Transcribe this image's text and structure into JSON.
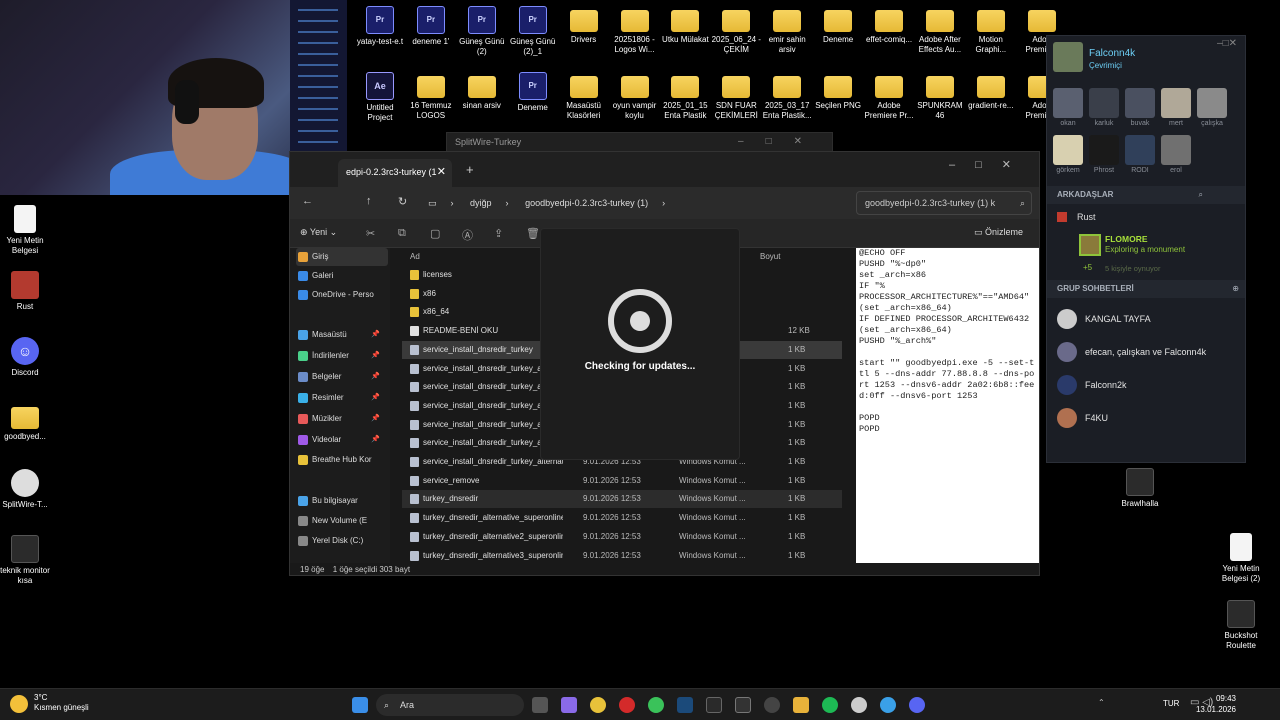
{
  "desktop_top_row": [
    {
      "label": "yatay-test-e.t",
      "kind": "proj"
    },
    {
      "label": "deneme 1'",
      "kind": "proj"
    },
    {
      "label": "Güneş Günü (2)",
      "kind": "proj"
    },
    {
      "label": "Güneş Günü (2)_1",
      "kind": "proj"
    },
    {
      "label": "Drivers",
      "kind": "folder"
    },
    {
      "label": "20251806 -Logos Wi...",
      "kind": "folder"
    },
    {
      "label": "Utku Mülakat",
      "kind": "folder"
    },
    {
      "label": "2025_06_24 - ÇEKİM",
      "kind": "folder"
    },
    {
      "label": "emir sahin arsiv",
      "kind": "folder"
    },
    {
      "label": "Deneme",
      "kind": "folder"
    },
    {
      "label": "effet-comiq...",
      "kind": "folder"
    },
    {
      "label": "Adobe After Effects Au...",
      "kind": "folder"
    },
    {
      "label": "Motion Graphi...",
      "kind": "folder"
    },
    {
      "label": "Adob Premiere",
      "kind": "folder"
    }
  ],
  "desktop_second_row": [
    {
      "label": "Untitled Project",
      "kind": "aep"
    },
    {
      "label": "16 Temmuz LOGOS",
      "kind": "folder"
    },
    {
      "label": "sinan arsiv",
      "kind": "folder"
    },
    {
      "label": "Deneme",
      "kind": "proj"
    },
    {
      "label": "Masaüstü Klasörleri",
      "kind": "folder"
    },
    {
      "label": "oyun vampir koylu",
      "kind": "folder"
    },
    {
      "label": "2025_01_15 Enta Plastik",
      "kind": "folder"
    },
    {
      "label": "SDN FUAR ÇEKİMLERİ",
      "kind": "folder"
    },
    {
      "label": "2025_03_17 Enta Plastik...",
      "kind": "folder"
    },
    {
      "label": "Seçilen PNG",
      "kind": "folder"
    },
    {
      "label": "Adobe Premiere Pr...",
      "kind": "folder"
    },
    {
      "label": "SPUNKRAM 46",
      "kind": "folder"
    },
    {
      "label": "gradient-re...",
      "kind": "folder"
    },
    {
      "label": "Adob Premiere",
      "kind": "folder"
    }
  ],
  "desktop_left": [
    {
      "label": "Yeni Metin Belgesi",
      "kind": "txt"
    },
    {
      "label": "Rust",
      "kind": "red"
    },
    {
      "label": "Discord",
      "kind": "discord"
    },
    {
      "label": "goodbyed...",
      "kind": "folder"
    },
    {
      "label": "SplitWire-T...",
      "kind": "split"
    },
    {
      "label": "teknik monitor kısa",
      "kind": "dark"
    }
  ],
  "desktop_right": [
    {
      "label": "Brawlhalla",
      "kind": "dark"
    },
    {
      "label": "Yeni Metin Belgesi (2)",
      "kind": "txt"
    },
    {
      "label": "Buckshot Roulette",
      "kind": "dark"
    }
  ],
  "splitwire": {
    "title": "SplitWire-Turkey"
  },
  "explorer": {
    "tab_title": "edpi-0.2.3rc3-turkey (1",
    "breadcrumb": [
      "dyiğp",
      "goodbyedpi-0.2.3rc3-turkey (1)"
    ],
    "search_placeholder": "goodbyedpi-0.2.3rc3-turkey (1) k",
    "new_button": "Yeni",
    "preview_button": "Önizleme",
    "col_name": "Ad",
    "col_size": "Boyut",
    "nav": [
      {
        "label": "Giriş",
        "color": "#e8a23a",
        "pin": false
      },
      {
        "label": "Galeri",
        "color": "#3a8be8",
        "pin": false
      },
      {
        "label": "OneDrive - Perso",
        "color": "#3a8be8",
        "pin": false
      },
      {
        "label": "Masaüstü",
        "color": "#4aa3e8",
        "pin": true
      },
      {
        "label": "İndirilenler",
        "color": "#4ad08a",
        "pin": true
      },
      {
        "label": "Belgeler",
        "color": "#6b8cc8",
        "pin": true
      },
      {
        "label": "Resimler",
        "color": "#3ab0e8",
        "pin": true
      },
      {
        "label": "Müzikler",
        "color": "#e85a5a",
        "pin": true
      },
      {
        "label": "Videolar",
        "color": "#a05ae8",
        "pin": true
      },
      {
        "label": "Breathe Hub Kor",
        "color": "#e8c23a",
        "pin": false
      },
      {
        "label": "Bu bilgisayar",
        "color": "#4aa3e8",
        "pin": false
      },
      {
        "label": "New Volume (E",
        "color": "#888888",
        "pin": false
      },
      {
        "label": "Yerel Disk (C:)",
        "color": "#888888",
        "pin": false
      }
    ],
    "files": [
      {
        "name": "licenses",
        "date": "",
        "type": "",
        "size": "",
        "kind": "folder"
      },
      {
        "name": "x86",
        "date": "",
        "type": "",
        "size": "",
        "kind": "folder"
      },
      {
        "name": "x86_64",
        "date": "",
        "type": "",
        "size": "",
        "kind": "folder"
      },
      {
        "name": "README-BENİ OKU",
        "date": "",
        "type": "",
        "size": "12 KB",
        "kind": "txt"
      },
      {
        "name": "service_install_dnsredir_turkey",
        "date": "",
        "type": "",
        "size": "1 KB",
        "kind": "cmd",
        "selected": true
      },
      {
        "name": "service_install_dnsredir_turkey_alte",
        "date": "",
        "type": "...",
        "size": "1 KB",
        "kind": "cmd"
      },
      {
        "name": "service_install_dnsredir_turkey_alte",
        "date": "",
        "type": "",
        "size": "1 KB",
        "kind": "cmd"
      },
      {
        "name": "service_install_dnsredir_turkey_alte",
        "date": "",
        "type": "",
        "size": "1 KB",
        "kind": "cmd"
      },
      {
        "name": "service_install_dnsredir_turkey_alte",
        "date": "",
        "type": "...",
        "size": "1 KB",
        "kind": "cmd"
      },
      {
        "name": "service_install_dnsredir_turkey_alte",
        "date": "",
        "type": "",
        "size": "1 KB",
        "kind": "cmd"
      },
      {
        "name": "service_install_dnsredir_turkey_alternativ...",
        "date": "9.01.2026 12:53",
        "type": "Windows Komut ...",
        "size": "1 KB",
        "kind": "cmd"
      },
      {
        "name": "service_remove",
        "date": "9.01.2026 12:53",
        "type": "Windows Komut ...",
        "size": "1 KB",
        "kind": "cmd"
      },
      {
        "name": "turkey_dnsredir",
        "date": "9.01.2026 12:53",
        "type": "Windows Komut ...",
        "size": "1 KB",
        "kind": "cmd",
        "hover": true
      },
      {
        "name": "turkey_dnsredir_alternative_superonline",
        "date": "9.01.2026 12:53",
        "type": "Windows Komut ...",
        "size": "1 KB",
        "kind": "cmd"
      },
      {
        "name": "turkey_dnsredir_alternative2_superonline",
        "date": "9.01.2026 12:53",
        "type": "Windows Komut ...",
        "size": "1 KB",
        "kind": "cmd"
      },
      {
        "name": "turkey_dnsredir_alternative3_superonline",
        "date": "9.01.2026 12:53",
        "type": "Windows Komut ...",
        "size": "1 KB",
        "kind": "cmd"
      }
    ],
    "preview_text": "@ECHO OFF\nPUSHD \"%~dp0\"\nset _arch=x86\nIF \"%\nPROCESSOR_ARCHITECTURE%\"==\"AMD64\"\n(set _arch=x86_64)\nIF DEFINED PROCESSOR_ARCHITEW6432\n(set _arch=x86_64)\nPUSHD \"%_arch%\"\n\nstart \"\" goodbyedpi.exe -5 --set-ttl 5 --dns-addr 77.88.8.8 --dns-port 1253 --dnsv6-addr 2a02:6b8::feed:0ff --dnsv6-port 1253\n\nPOPD\nPOPD",
    "status_count": "19 öğe",
    "status_selected": "1 öğe seçildi 303 bayt"
  },
  "update": {
    "text": "Checking for updates..."
  },
  "steam": {
    "user_name": "Falconn4k",
    "user_status": "Çevrimiçi",
    "avatars": [
      {
        "label": "okan",
        "color": "#5a6070"
      },
      {
        "label": "karluk",
        "color": "#3a3f4a"
      },
      {
        "label": "buvak",
        "color": "#4a5060"
      },
      {
        "label": "mert",
        "color": "#b0a898"
      },
      {
        "label": "çalışka",
        "color": "#8a8a8a"
      },
      {
        "label": "görkem",
        "color": "#d8d0b0"
      },
      {
        "label": "Phrost",
        "color": "#1a1a1a"
      },
      {
        "label": "RODI",
        "color": "#30405a"
      },
      {
        "label": "erol",
        "color": "#707070"
      }
    ],
    "friends_header": "ARKADAŞLAR",
    "friend_group": "Rust",
    "playing_name": "FLOMORE",
    "playing_status": "Exploring a monument",
    "playing_extra": "+5",
    "playing_count": "5 kişiyle oynuyor",
    "groups_header": "GRUP SOHBETLERİ",
    "groups": [
      {
        "label": "KANGAL TAYFA",
        "color": "#cccccc"
      },
      {
        "label": "efecan, çalışkan ve Falconn4k",
        "color": "#6a6a8a"
      },
      {
        "label": "Falconn2k",
        "color": "#2a3a6a"
      },
      {
        "label": "F4KU",
        "color": "#b07050"
      }
    ]
  },
  "taskbar": {
    "temp": "3°C",
    "weather": "Kısmen güneşli",
    "search": "Ara",
    "lang": "TUR",
    "time": "09:43",
    "date": "13.01.2026"
  }
}
